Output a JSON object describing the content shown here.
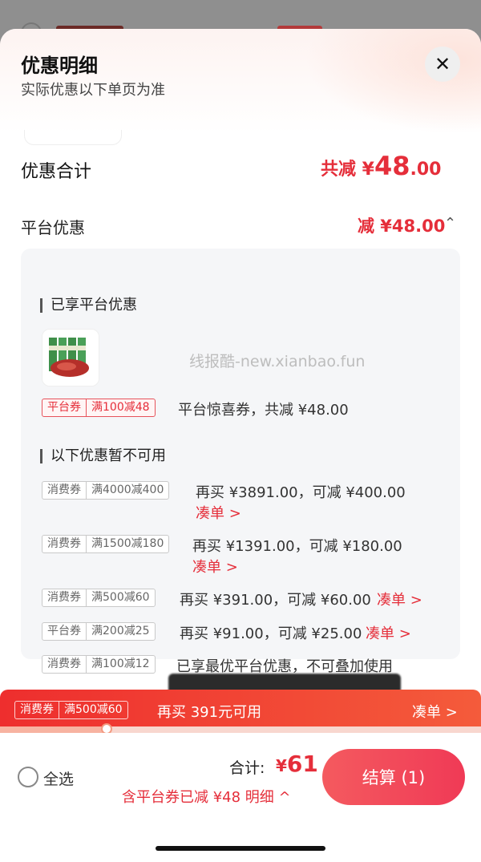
{
  "sheet": {
    "title": "优惠明细",
    "subtitle": "实际优惠以下单页为准",
    "close_icon": "✕"
  },
  "summary": {
    "label": "优惠合计",
    "prefix": "共减 ¥",
    "amount_int": "48",
    "amount_dec": ".00"
  },
  "platform": {
    "label": "平台优惠",
    "value": "减 ¥48.00",
    "chevron": "⌃"
  },
  "enjoyed": {
    "heading": "已享平台优惠",
    "watermark": "线报酷-new.xianbao.fun",
    "coupon": {
      "type": "平台券",
      "rule": "满100减48",
      "desc": "平台惊喜券，共减 ¥48.00"
    }
  },
  "unavailable": {
    "heading": "以下优惠暂不可用",
    "items": [
      {
        "type": "消费券",
        "rule": "满4000减400",
        "desc": "再买 ¥3891.00，可减 ¥400.00",
        "link": "凑单 >"
      },
      {
        "type": "消费券",
        "rule": "满1500减180",
        "desc": "再买 ¥1391.00，可减 ¥180.00",
        "link": "凑单 >"
      },
      {
        "type": "消费券",
        "rule": "满500减60",
        "desc": "再买 ¥391.00，可减 ¥60.00",
        "link": "凑单 >"
      },
      {
        "type": "平台券",
        "rule": "满200减25",
        "desc": "再买 ¥91.00，可减 ¥25.00",
        "link": "凑单 >"
      },
      {
        "type": "消费券",
        "rule": "满100减12",
        "desc": "已享最优平台优惠，不可叠加使用",
        "link": ""
      }
    ]
  },
  "promo_bar": {
    "type": "消费券",
    "rule": "满500减60",
    "text": "再买 391元可用",
    "link": "凑单 >",
    "progress": 0.22
  },
  "footer": {
    "select_all": "全选",
    "total_label": "合计:",
    "currency": "¥",
    "total": "61",
    "saved": "含平台券已减 ¥48 明细 ^",
    "checkout": "结算 (1)"
  },
  "colors": {
    "accent": "#e52e3a",
    "promo_bg": "#ee2e2e"
  }
}
